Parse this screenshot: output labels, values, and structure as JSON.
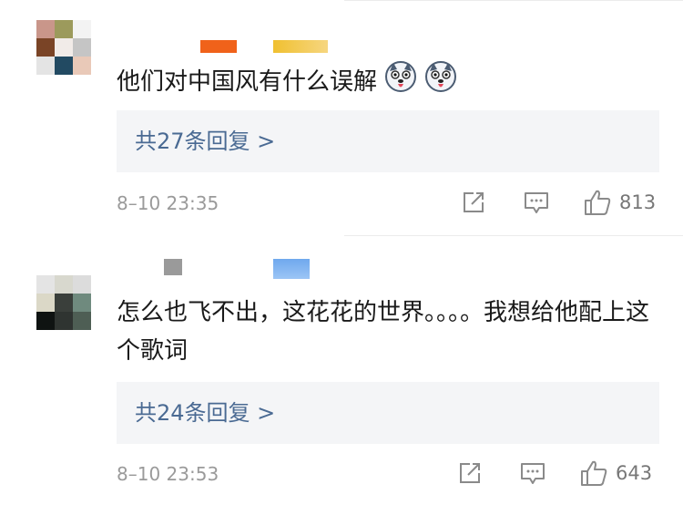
{
  "comments": [
    {
      "text": "他们对中国风有什么误解",
      "emoji_icons": [
        "husky-emoji-icon",
        "husky-emoji-icon"
      ],
      "replies_label": "共27条回复 >",
      "timestamp": "8–10 23:35",
      "like_count": "813",
      "avatar_colors": [
        "#c9968a",
        "#9c9a5c",
        "#f3f3f3",
        "#7a4426",
        "#f1ebe8",
        "#c5c5c5",
        "#e4e4e4",
        "#224a62",
        "#e9c9b8"
      ]
    },
    {
      "text": "怎么也飞不出，这花花的世界。。。。我想给他配上这个歌词",
      "replies_label": "共24条回复 >",
      "timestamp": "8–10 23:53",
      "like_count": "643",
      "avatar_colors": [
        "#e4e4e4",
        "#d8d8ce",
        "#dcdcdc",
        "#dbd8c7",
        "#3a3f3b",
        "#6f8a7e",
        "#0f1312",
        "#2f3431",
        "#4e5e54"
      ]
    }
  ],
  "colors": {
    "reply_link": "#4a6a93",
    "meta_text": "#9a9a9a",
    "reply_bg": "#f4f5f7"
  }
}
